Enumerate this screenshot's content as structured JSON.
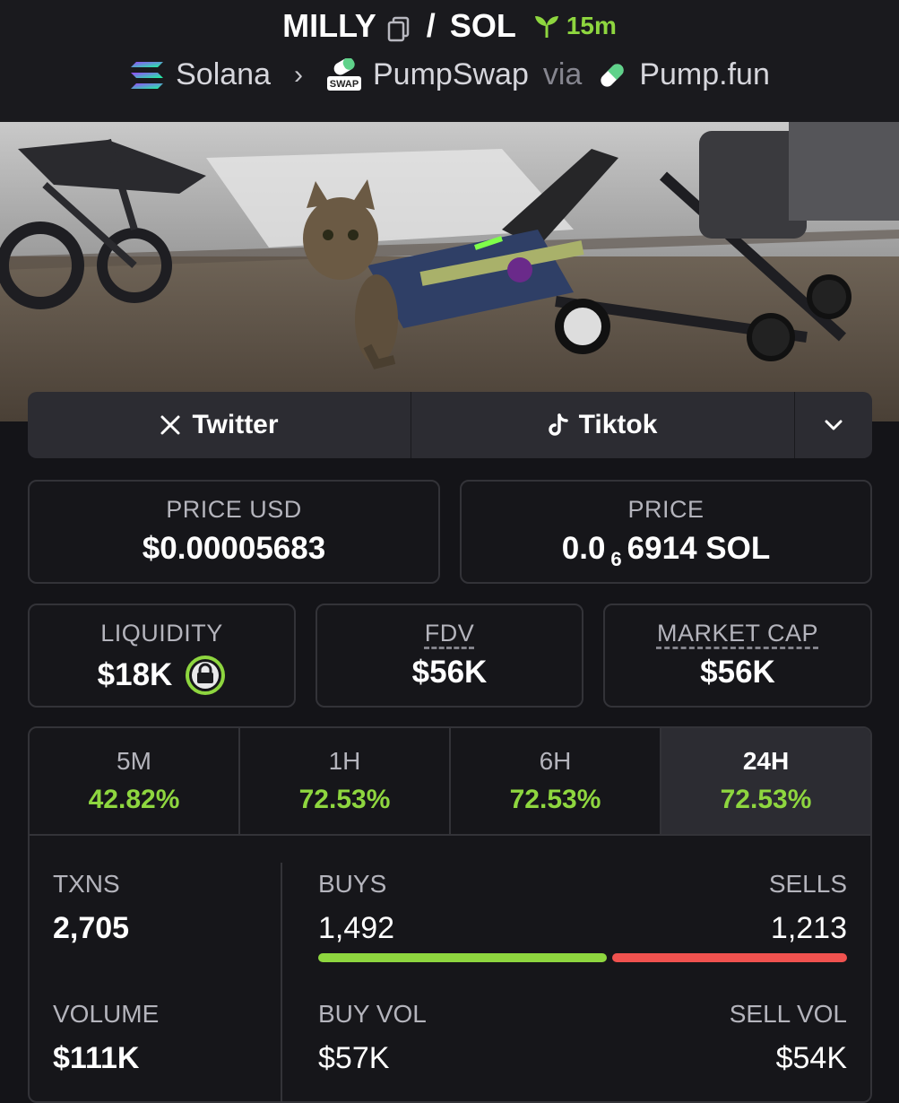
{
  "header": {
    "token": "MILLY",
    "slash": "/",
    "quote": "SOL",
    "age": "15m",
    "chain": "Solana",
    "dex": "PumpSwap",
    "via": "via",
    "launchpad": "Pump.fun",
    "swap_badge": "SWAP"
  },
  "socials": {
    "twitter_label": "Twitter",
    "tiktok_label": "Tiktok"
  },
  "price": {
    "usd_label": "PRICE USD",
    "usd_value": "$0.00005683",
    "native_label": "PRICE",
    "native_prefix": "0.0",
    "native_zeros": "6",
    "native_suffix": "6914 SOL"
  },
  "metrics": {
    "liquidity_label": "LIQUIDITY",
    "liquidity_value": "$18K",
    "fdv_label": "FDV",
    "fdv_value": "$56K",
    "mcap_label": "MARKET CAP",
    "mcap_value": "$56K"
  },
  "timeframes": [
    {
      "label": "5M",
      "change": "42.82%"
    },
    {
      "label": "1H",
      "change": "72.53%"
    },
    {
      "label": "6H",
      "change": "72.53%"
    },
    {
      "label": "24H",
      "change": "72.53%"
    }
  ],
  "active_timeframe": "24H",
  "activity": {
    "txns_label": "TXNS",
    "txns_value": "2,705",
    "buys_label": "BUYS",
    "buys_value": "1,492",
    "sells_label": "SELLS",
    "sells_value": "1,213",
    "buy_ratio": 0.5516,
    "volume_label": "VOLUME",
    "volume_value": "$111K",
    "buy_vol_label": "BUY VOL",
    "buy_vol_value": "$57K",
    "sell_vol_label": "SELL VOL",
    "sell_vol_value": "$54K"
  },
  "colors": {
    "positive": "#8ed63f",
    "negative": "#f0524f",
    "background": "#141418",
    "panel": "#2c2c32"
  }
}
